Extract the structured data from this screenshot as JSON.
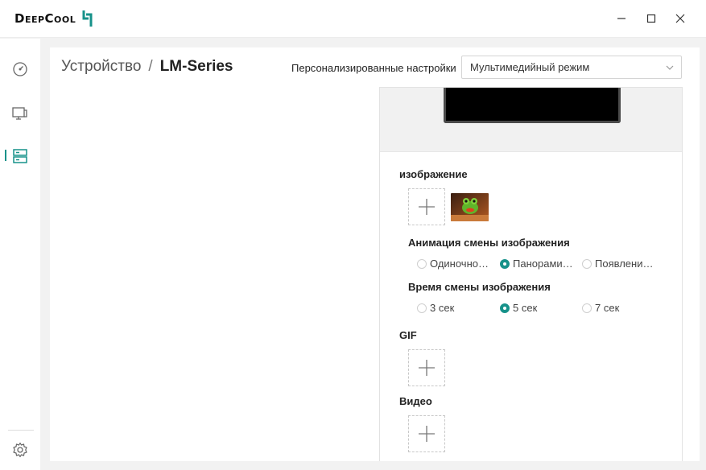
{
  "app": {
    "logo_text": "DeepCool",
    "accent_color": "#17928a"
  },
  "window_controls": {
    "minimize_icon": "minimize-icon",
    "maximize_icon": "maximize-icon",
    "close_icon": "close-icon"
  },
  "sidebar": {
    "items": [
      {
        "id": "dashboard",
        "icon": "gauge-icon",
        "active": false
      },
      {
        "id": "devices",
        "icon": "monitor-icon",
        "active": false
      },
      {
        "id": "device-list",
        "icon": "server-icon",
        "active": true
      }
    ],
    "settings_icon": "gear-icon"
  },
  "breadcrumb": {
    "parent": "Устройство",
    "separator": "/",
    "current": "LM-Series"
  },
  "preset": {
    "label": "Персонализированные настройки",
    "selected": "Мультимедийный режим"
  },
  "image_section": {
    "title": "изображение",
    "thumbnail_alt": "frog-image-thumbnail",
    "animation": {
      "title": "Анимация смены изображения",
      "options": [
        {
          "label": "Одиночно…",
          "checked": false
        },
        {
          "label": "Панорами…",
          "checked": true
        },
        {
          "label": "Появлени…",
          "checked": false
        }
      ]
    },
    "interval": {
      "title": "Время смены изображения",
      "options": [
        {
          "label": "3 сек",
          "checked": false
        },
        {
          "label": "5 сек",
          "checked": true
        },
        {
          "label": "7 сек",
          "checked": false
        }
      ]
    }
  },
  "gif_section": {
    "title": "GIF"
  },
  "video_section": {
    "title": "Видео"
  }
}
